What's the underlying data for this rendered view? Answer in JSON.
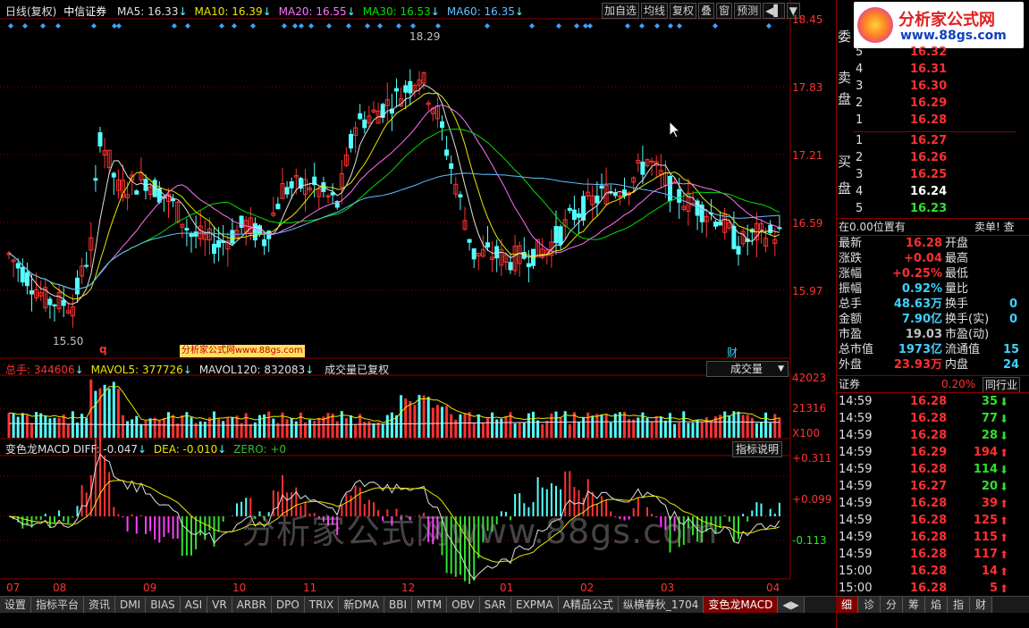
{
  "header": {
    "period": "日线(复权)",
    "stock": "中信证券",
    "ma": [
      {
        "label": "MA5: 16.33",
        "arrow": "↓",
        "color": "#e0e0e0"
      },
      {
        "label": "MA10: 16.39",
        "arrow": "↓",
        "color": "#e8e800"
      },
      {
        "label": "MA20: 16.55",
        "arrow": "↓",
        "color": "#ff70ff"
      },
      {
        "label": "MA30: 16.53",
        "arrow": "↓",
        "color": "#00e000"
      },
      {
        "label": "MA60: 16.35",
        "arrow": "↓",
        "color": "#60c0ff"
      }
    ],
    "buttons": [
      "加自选",
      "均线",
      "复权",
      "叠",
      "窗",
      "预测"
    ],
    "more": "▼"
  },
  "price_axis": [
    "18.45",
    "17.83",
    "17.21",
    "16.59",
    "15.97"
  ],
  "markers": {
    "high": "18.29",
    "low": "15.50",
    "q": "q",
    "cai": "财"
  },
  "watermark_badge": "分析家公式网www.88gs.com",
  "volume_panel": {
    "label_total": "总手: 344606",
    "label_mavol5": "MAVOL5: 377726",
    "label_mavol120": "MAVOL120: 832083",
    "label_note": "成交量已复权",
    "selector": "成交量",
    "axis": [
      "42023",
      "21316",
      "X100"
    ]
  },
  "macd_panel": {
    "label_name": "变色龙MACD DIFF: -0.047",
    "label_dea": "DEA: -0.010",
    "label_zero": "ZERO: +0",
    "help": "指标说明",
    "axis": [
      "+0.311",
      "+0.099",
      "-0.113"
    ]
  },
  "big_watermark": "分析家公式网www.88gs.com",
  "months": [
    "07",
    "08",
    "09",
    "10",
    "11",
    "12",
    "01",
    "02",
    "03",
    "04"
  ],
  "bottom_tabs": [
    "设置",
    "指标平台",
    "资讯",
    "DMI",
    "BIAS",
    "ASI",
    "VR",
    "ARBR",
    "DPO",
    "TRIX",
    "新DMA",
    "BBI",
    "MTM",
    "OBV",
    "SAR",
    "EXPMA",
    "A精品公式",
    "纵横春秋_1704",
    "变色龙MACD"
  ],
  "right_panel": {
    "logo_text": "分析家公式网",
    "logo_url": "www.88gs.com",
    "sell_label": [
      "委",
      "卖",
      "盘"
    ],
    "buy_label": [
      "买",
      "盘"
    ],
    "sell": [
      {
        "n": "5",
        "p": "16.32"
      },
      {
        "n": "4",
        "p": "16.31"
      },
      {
        "n": "3",
        "p": "16.30"
      },
      {
        "n": "2",
        "p": "16.29"
      },
      {
        "n": "1",
        "p": "16.28"
      }
    ],
    "buy": [
      {
        "n": "1",
        "p": "16.27",
        "c": "#ff3030"
      },
      {
        "n": "2",
        "p": "16.26",
        "c": "#ff3030"
      },
      {
        "n": "3",
        "p": "16.25",
        "c": "#ff3030"
      },
      {
        "n": "4",
        "p": "16.24",
        "c": "#ffffff"
      },
      {
        "n": "5",
        "p": "16.23",
        "c": "#30e030"
      }
    ],
    "position_text": "在0.00位置有",
    "sell_single": "卖单! 查",
    "stats": [
      {
        "k": "最新",
        "v": "16.28",
        "vc": "#ff3030",
        "k2": "开盘"
      },
      {
        "k": "涨跌",
        "v": "+0.04",
        "vc": "#ff3030",
        "k2": "最高"
      },
      {
        "k": "涨幅",
        "v": "+0.25%",
        "vc": "#ff3030",
        "k2": "最低"
      },
      {
        "k": "振幅",
        "v": "0.92%",
        "vc": "#40d0ff",
        "k2": "量比"
      },
      {
        "k": "总手",
        "v": "48.63万",
        "vc": "#40d0ff",
        "k2": "换手",
        "v2": "0"
      },
      {
        "k": "金额",
        "v": "7.90亿",
        "vc": "#40d0ff",
        "k2": "换手(实)",
        "v2": "0"
      },
      {
        "k": "市盈",
        "v": "19.03",
        "vc": "#c0c0c0",
        "k2": "市盈(动)"
      },
      {
        "k": "总市值",
        "v": "1973亿",
        "vc": "#40d0ff",
        "k2": "流通值",
        "v2": "15"
      },
      {
        "k": "外盘",
        "v": "23.93万",
        "vc": "#ff3030",
        "k2": "内盘",
        "v2": "24"
      }
    ],
    "ticker_name": "证券",
    "ticker_pct": "0.20%",
    "ticker_btn": "同行业",
    "ticks": [
      {
        "t": "14:59",
        "p": "16.28",
        "v": "35",
        "d": "down"
      },
      {
        "t": "14:59",
        "p": "16.28",
        "v": "77",
        "d": "down"
      },
      {
        "t": "14:59",
        "p": "16.28",
        "v": "28",
        "d": "down"
      },
      {
        "t": "14:59",
        "p": "16.29",
        "v": "194",
        "d": "up"
      },
      {
        "t": "14:59",
        "p": "16.28",
        "v": "114",
        "d": "down"
      },
      {
        "t": "14:59",
        "p": "16.27",
        "v": "20",
        "d": "down"
      },
      {
        "t": "14:59",
        "p": "16.28",
        "v": "39",
        "d": "up"
      },
      {
        "t": "14:59",
        "p": "16.28",
        "v": "125",
        "d": "up"
      },
      {
        "t": "14:59",
        "p": "16.28",
        "v": "115",
        "d": "up"
      },
      {
        "t": "14:59",
        "p": "16.28",
        "v": "117",
        "d": "up"
      },
      {
        "t": "15:00",
        "p": "16.28",
        "v": "14",
        "d": "up"
      },
      {
        "t": "15:00",
        "p": "16.28",
        "v": "5",
        "d": "up"
      }
    ],
    "right_tabs": [
      "细",
      "诊",
      "分",
      "筹",
      "焰",
      "指",
      "财"
    ]
  },
  "colors": {
    "up": "#ff3232",
    "down": "#54ffff",
    "grid": "#8a0000",
    "green": "#30e030"
  }
}
